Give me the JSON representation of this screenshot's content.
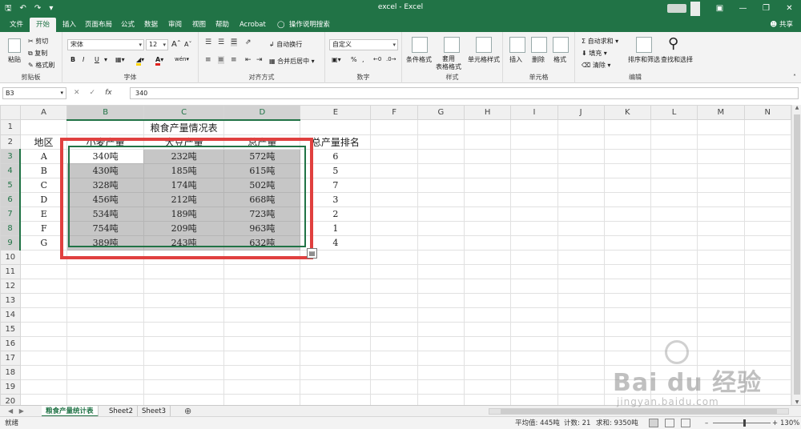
{
  "window": {
    "title": "excel - Excel",
    "qat": [
      "save-icon",
      "undo-icon",
      "redo-icon",
      "customize-icon"
    ],
    "controls": [
      "ribbon-options-icon",
      "minimize-icon",
      "restore-icon",
      "close-icon"
    ]
  },
  "tabs": [
    {
      "label": "文件"
    },
    {
      "label": "开始"
    },
    {
      "label": "插入"
    },
    {
      "label": "页面布局"
    },
    {
      "label": "公式"
    },
    {
      "label": "数据"
    },
    {
      "label": "审阅"
    },
    {
      "label": "视图"
    },
    {
      "label": "帮助"
    },
    {
      "label": "Acrobat"
    }
  ],
  "tell_me": "操作说明搜索",
  "share": "共享",
  "ribbon": {
    "clipboard": {
      "paste": "粘贴",
      "cut": "剪切",
      "copy": "复制",
      "format_painter": "格式刷",
      "label": "剪贴板"
    },
    "font": {
      "name": "宋体",
      "size": "12",
      "label": "字体",
      "bold": "B",
      "italic": "I",
      "underline": "U",
      "grow": "A",
      "shrink": "A",
      "font_color": "A",
      "fill_color": "A",
      "phonetic": "wén"
    },
    "alignment": {
      "wrap": "自动换行",
      "merge": "合并后居中",
      "label": "对齐方式"
    },
    "number": {
      "format": "自定义",
      "percent": "%",
      "comma": ",",
      "label": "数字"
    },
    "styles": {
      "conditional": "条件格式",
      "table": "套用\n表格格式",
      "cell_styles": "单元格样式",
      "label": "样式"
    },
    "cells": {
      "insert": "插入",
      "delete": "删除",
      "format": "格式",
      "label": "单元格"
    },
    "editing": {
      "autosum": "自动求和",
      "fill": "填充",
      "clear": "清除",
      "sort": "排序和筛选",
      "find": "查找和选择",
      "label": "编辑"
    }
  },
  "formula_bar": {
    "name_box": "B3",
    "value": "340",
    "fx": "fx"
  },
  "sheet": {
    "columns": [
      "A",
      "B",
      "C",
      "D",
      "E",
      "F",
      "G",
      "H",
      "I",
      "J",
      "K",
      "L",
      "M",
      "N"
    ],
    "rows": [
      "1",
      "2",
      "3",
      "4",
      "5",
      "6",
      "7",
      "8",
      "9",
      "10",
      "11",
      "12",
      "13",
      "14",
      "15",
      "16",
      "17",
      "18",
      "19",
      "20"
    ],
    "title": "粮食产量情况表",
    "headers": [
      "地区",
      "小麦产量",
      "大豆产量",
      "总产量",
      "总产量排名"
    ],
    "data": [
      [
        "A",
        "340吨",
        "232吨",
        "572吨",
        "6"
      ],
      [
        "B",
        "430吨",
        "185吨",
        "615吨",
        "5"
      ],
      [
        "C",
        "328吨",
        "174吨",
        "502吨",
        "7"
      ],
      [
        "D",
        "456吨",
        "212吨",
        "668吨",
        "3"
      ],
      [
        "E",
        "534吨",
        "189吨",
        "723吨",
        "2"
      ],
      [
        "F",
        "754吨",
        "209吨",
        "963吨",
        "1"
      ],
      [
        "G",
        "389吨",
        "243吨",
        "632吨",
        "4"
      ]
    ]
  },
  "sheet_tabs": [
    {
      "label": "粮食产量统计表"
    },
    {
      "label": "Sheet2"
    },
    {
      "label": "Sheet3"
    }
  ],
  "status": {
    "ready": "就绪",
    "average": "平均值: 445吨",
    "count": "计数: 21",
    "sum": "求和: 9350吨",
    "zoom": "130%"
  },
  "watermark": {
    "brand": "Bai du 经验",
    "url": "jingyan.baidu.com"
  },
  "colors": {
    "excel_green": "#217346",
    "highlight_red": "#e0403f",
    "selection_gray": "#c6c6c6"
  }
}
